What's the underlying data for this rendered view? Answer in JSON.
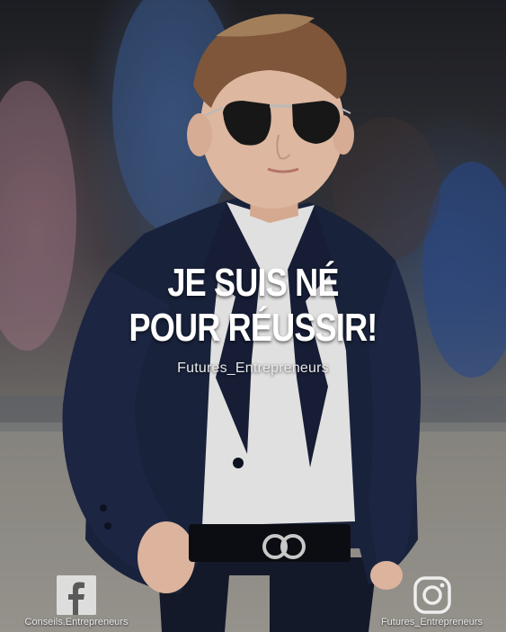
{
  "post": {
    "headline_line1": "JE SUIS NÉ",
    "headline_line2": "POUR RÉUSSIR!",
    "handle": "Futures_Entrepreneurs"
  },
  "social": {
    "facebook": {
      "icon": "facebook-icon",
      "label": "Conseils.Entrepreneurs"
    },
    "instagram": {
      "icon": "instagram-icon",
      "label": "Futures_Entrepreneurs"
    }
  },
  "colors": {
    "text": "#ffffff",
    "jacket": "#1c2540",
    "shirt": "#f4f4f4"
  }
}
